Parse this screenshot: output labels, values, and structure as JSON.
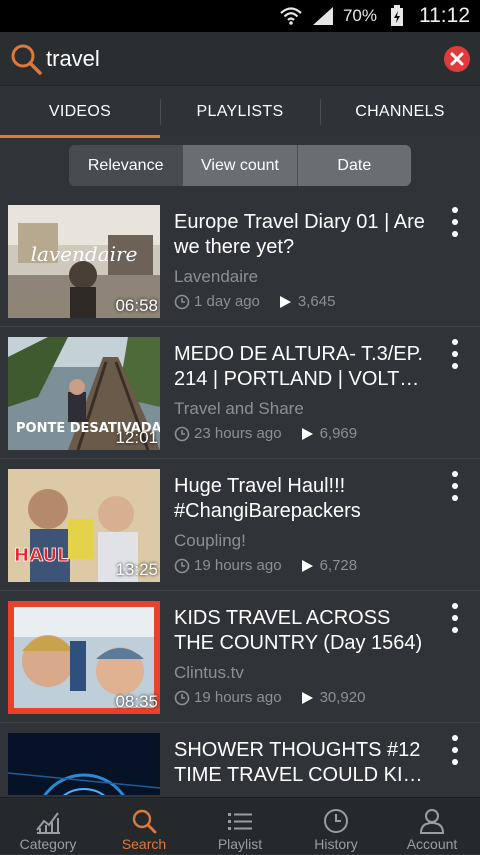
{
  "status": {
    "battery": "70%",
    "time": "11:12"
  },
  "search": {
    "query": "travel"
  },
  "tabs": [
    {
      "label": "VIDEOS"
    },
    {
      "label": "PLAYLISTS"
    },
    {
      "label": "CHANNELS"
    }
  ],
  "sort": {
    "options": [
      "Relevance",
      "View count",
      "Date"
    ],
    "selected": "Relevance"
  },
  "videos": [
    {
      "title": "Europe Travel Diary 01 | Are we there yet?",
      "channel": "Lavendaire",
      "age": "1 day ago",
      "views": "3,645",
      "duration": "06:58",
      "thumb_text": "lavendaire"
    },
    {
      "title": "MEDO DE ALTURA- T.3/EP. 214 | PORTLAND | VOLT…",
      "channel": "Travel and Share",
      "age": "23 hours ago",
      "views": "6,969",
      "duration": "12:01",
      "thumb_text": "PONTE DESATIVADA"
    },
    {
      "title": "Huge Travel Haul!!! #ChangiBarepackers",
      "channel": "Coupling!",
      "age": "19 hours ago",
      "views": "6,728",
      "duration": "13:25",
      "thumb_text": "HAUL"
    },
    {
      "title": "KIDS TRAVEL ACROSS THE COUNTRY (Day 1564)",
      "channel": "Clintus.tv",
      "age": "19 hours ago",
      "views": "30,920",
      "duration": "08:35"
    },
    {
      "title": "SHOWER THOUGHTS #12 TIME TRAVEL COULD KI…",
      "channel": "",
      "age": "",
      "views": "",
      "duration": ""
    }
  ],
  "nav": [
    {
      "label": "Category",
      "icon": "chart-icon"
    },
    {
      "label": "Search",
      "icon": "search-icon",
      "active": true
    },
    {
      "label": "Playlist",
      "icon": "list-icon"
    },
    {
      "label": "History",
      "icon": "clock-icon"
    },
    {
      "label": "Account",
      "icon": "person-icon"
    }
  ],
  "colors": {
    "accent": "#e0783a",
    "clear": "#e23a3a"
  }
}
